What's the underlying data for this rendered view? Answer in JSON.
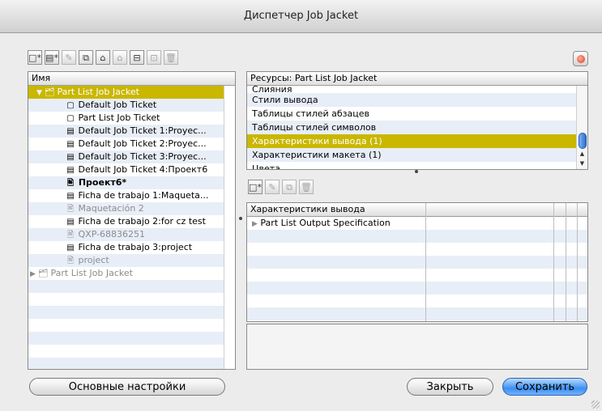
{
  "window": {
    "title": "Диспетчер Job Jacket"
  },
  "toolbar_top": {
    "icons": [
      "new-jacket-icon",
      "new-ticket-icon",
      "edit-icon",
      "duplicate-icon",
      "open-folder-icon",
      "folder-link-icon",
      "import-icon",
      "export-icon",
      "trash-icon"
    ],
    "glyphs": [
      "□*",
      "▤*",
      "✎",
      "⧉",
      "⌂",
      "⌂",
      "⊟",
      "⊡",
      "🗑"
    ]
  },
  "tree": {
    "column_header": "Имя",
    "items": [
      {
        "label": "Part List Job Jacket",
        "level": 0,
        "selected": true,
        "expanded": true
      },
      {
        "label": "Default Job Ticket",
        "level": 1,
        "icon": "ticket"
      },
      {
        "label": "Part List Job Ticket",
        "level": 1,
        "icon": "ticket"
      },
      {
        "label": "Default Job Ticket 1:Proyec...",
        "level": 1,
        "icon": "layout"
      },
      {
        "label": "Default Job Ticket 2:Proyec...",
        "level": 1,
        "icon": "layout"
      },
      {
        "label": "Default Job Ticket 3:Proyec...",
        "level": 1,
        "icon": "layout"
      },
      {
        "label": "Default Job Ticket 4:Проект6",
        "level": 1,
        "icon": "layout"
      },
      {
        "label": "Проект6*",
        "level": 2,
        "icon": "project",
        "bold": true
      },
      {
        "label": "Ficha de trabajo 1:Maqueta...",
        "level": 1,
        "icon": "layout"
      },
      {
        "label": "Maquetación 2",
        "level": 2,
        "icon": "project",
        "gray": true
      },
      {
        "label": "Ficha de trabajo 2:for cz test",
        "level": 1,
        "icon": "layout"
      },
      {
        "label": "QXP-68836251",
        "level": 2,
        "icon": "project",
        "gray": true
      },
      {
        "label": "Ficha de trabajo 3:project",
        "level": 1,
        "icon": "layout"
      },
      {
        "label": "project",
        "level": 2,
        "icon": "project",
        "gray": true
      },
      {
        "label": "Part List Job Jacket",
        "level": 0,
        "gray": true,
        "expanded": false
      }
    ]
  },
  "resources": {
    "header": "Ресурсы: Part List Job Jacket",
    "items": [
      {
        "label": "Слияния"
      },
      {
        "label": "Стили вывода"
      },
      {
        "label": "Таблицы стилей абзацев"
      },
      {
        "label": "Таблицы стилей символов"
      },
      {
        "label": "Характеристики вывода (1)",
        "selected": true
      },
      {
        "label": "Характеристики макета (1)"
      },
      {
        "label": "Цвета"
      }
    ]
  },
  "toolbar_bottom": {
    "icons": [
      "new-spec-icon",
      "edit-spec-icon",
      "duplicate-spec-icon",
      "delete-spec-icon"
    ],
    "glyphs": [
      "□*",
      "✎",
      "⧉",
      "🗑"
    ]
  },
  "spec": {
    "column_header": "Характеристики вывода",
    "items": [
      {
        "label": "Part List Output Specification"
      }
    ]
  },
  "buttons": {
    "defaults": "Основные настройки",
    "close": "Закрыть",
    "save": "Сохранить"
  }
}
